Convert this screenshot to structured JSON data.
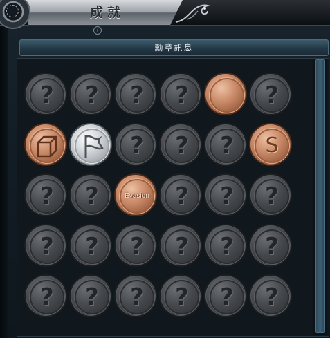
{
  "window": {
    "title": "成就",
    "info_icon": "info-icon"
  },
  "header": {
    "label": "勳章訊息"
  },
  "colors": {
    "bronze": "#c98a68",
    "silver": "#c9cdd1",
    "locked": "#45484c",
    "header": "#2b4556"
  },
  "medals": [
    [
      {
        "state": "locked",
        "glyph": "?"
      },
      {
        "state": "locked",
        "glyph": "?"
      },
      {
        "state": "locked",
        "glyph": "?"
      },
      {
        "state": "locked",
        "glyph": "?"
      },
      {
        "state": "bronze",
        "glyph": "",
        "icon": "blank-medal-icon"
      },
      {
        "state": "locked",
        "glyph": "?"
      }
    ],
    [
      {
        "state": "bronze",
        "glyph": "",
        "icon": "cube-icon"
      },
      {
        "state": "silver",
        "glyph": "",
        "icon": "flag-icon"
      },
      {
        "state": "locked",
        "glyph": "?"
      },
      {
        "state": "locked",
        "glyph": "?"
      },
      {
        "state": "locked",
        "glyph": "?"
      },
      {
        "state": "bronze",
        "glyph": "S",
        "icon": "letter-s-icon"
      }
    ],
    [
      {
        "state": "locked",
        "glyph": "?"
      },
      {
        "state": "locked",
        "glyph": "?"
      },
      {
        "state": "bronze",
        "glyph": "",
        "word": "Evasion"
      },
      {
        "state": "locked",
        "glyph": "?"
      },
      {
        "state": "locked",
        "glyph": "?"
      },
      {
        "state": "locked",
        "glyph": "?"
      }
    ],
    [
      {
        "state": "locked",
        "glyph": "?"
      },
      {
        "state": "locked",
        "glyph": "?"
      },
      {
        "state": "locked",
        "glyph": "?"
      },
      {
        "state": "locked",
        "glyph": "?"
      },
      {
        "state": "locked",
        "glyph": "?"
      },
      {
        "state": "locked",
        "glyph": "?"
      }
    ],
    [
      {
        "state": "locked",
        "glyph": "?"
      },
      {
        "state": "locked",
        "glyph": "?"
      },
      {
        "state": "locked",
        "glyph": "?"
      },
      {
        "state": "locked",
        "glyph": "?"
      },
      {
        "state": "locked",
        "glyph": "?"
      },
      {
        "state": "locked",
        "glyph": "?"
      }
    ]
  ]
}
